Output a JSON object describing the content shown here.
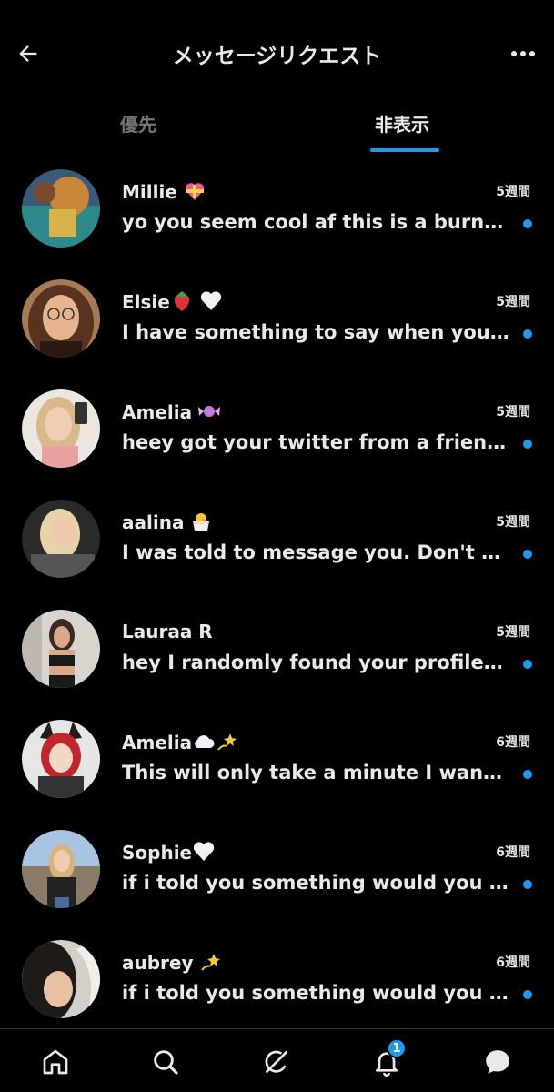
{
  "header": {
    "title": "メッセージリクエスト",
    "back_icon": "arrow-left-icon",
    "more_icon": "more-horizontal-icon"
  },
  "tabs": [
    {
      "label": "優先",
      "active": false
    },
    {
      "label": "非表示",
      "active": true
    }
  ],
  "accent_color": "#1d9bf0",
  "requests": [
    {
      "name": "Millie",
      "emoji": "heart-with-ribbon",
      "time": "5週間",
      "preview": "yo you seem cool af this is a burner account, i hope you don't mind",
      "unread": true
    },
    {
      "name": "Elsie",
      "emoji": "strawberry white-heart",
      "time": "5週間",
      "preview": "I have something to say when you get a chance, can i ask you",
      "unread": true
    },
    {
      "name": "Amelia",
      "emoji": "candy",
      "time": "5週間",
      "preview": "heey got your twitter from a friend of mine, hope that's ok",
      "unread": true
    },
    {
      "name": "aalina",
      "emoji": "hatching-chick",
      "time": "5週間",
      "preview": "I was told to message you. Don't ask me who told me lol",
      "unread": true
    },
    {
      "name": "Lauraa R",
      "emoji": "",
      "time": "5週間",
      "preview": "hey I randomly found your profile and thought you seemed nice",
      "unread": true
    },
    {
      "name": "Amelia",
      "emoji": "cloud dizzy",
      "time": "6週間",
      "preview": "This will only take a minute I wanted to ask you something",
      "unread": true
    },
    {
      "name": "Sophie",
      "emoji": "white-heart",
      "time": "6週間",
      "preview": "if i told you something would you judge me for it honestly",
      "unread": true
    },
    {
      "name": "aubrey",
      "emoji": "dizzy",
      "time": "6週間",
      "preview": "if i told you something would you judge me for it honestly",
      "unread": true
    }
  ],
  "bottom_nav": [
    {
      "name": "home",
      "icon": "home-icon"
    },
    {
      "name": "search",
      "icon": "search-icon"
    },
    {
      "name": "grok",
      "icon": "grok-icon"
    },
    {
      "name": "notifications",
      "icon": "bell-icon",
      "badge": "1"
    },
    {
      "name": "messages",
      "icon": "message-icon"
    }
  ]
}
